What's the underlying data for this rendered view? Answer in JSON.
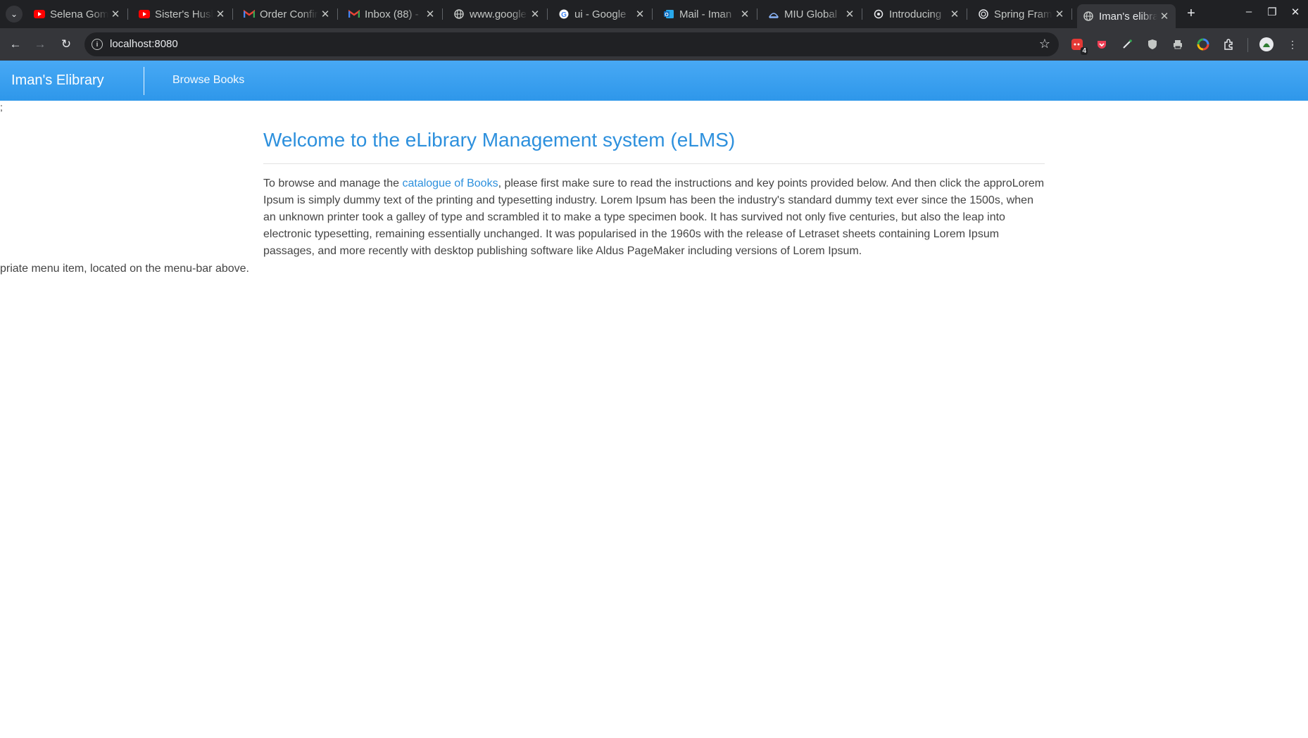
{
  "browser": {
    "tabs": [
      {
        "title": "Selena Gomez",
        "favicon": "youtube-icon",
        "color": "#ff0000"
      },
      {
        "title": "Sister's Husband",
        "favicon": "youtube-icon",
        "color": "#ff0000"
      },
      {
        "title": "Order Confirmation",
        "favicon": "gmail-icon",
        "color": "#ea4335"
      },
      {
        "title": "Inbox (88) -",
        "favicon": "gmail-icon",
        "color": "#ea4335"
      },
      {
        "title": "www.google",
        "favicon": "globe-icon",
        "color": "#c4c7c5"
      },
      {
        "title": "ui - Google",
        "favicon": "google-icon",
        "color": "#ffffff"
      },
      {
        "title": "Mail - Iman",
        "favicon": "outlook-icon",
        "color": "#0f6cbd"
      },
      {
        "title": "MIU Global",
        "favicon": "miu-icon",
        "color": "#8ab4f8"
      },
      {
        "title": "Introducing",
        "favicon": "openai-icon",
        "color": "#e8eaed"
      },
      {
        "title": "Spring Framework",
        "favicon": "spring-icon",
        "color": "#e8eaed"
      },
      {
        "title": "Iman's elibrary",
        "favicon": "globe-icon",
        "color": "#c4c7c5",
        "active": true
      }
    ],
    "url": "localhost:8080",
    "extension_badge": "4"
  },
  "app": {
    "brand": "Iman's Elibrary",
    "nav_link": "Browse Books",
    "stray_text": ";",
    "heading": "Welcome to the eLibrary Management system (eLMS)",
    "para_before_link": "To browse and manage the ",
    "link_text": "catalogue of Books",
    "para_after_link": ", please first make sure to read the instructions and key points provided below. And then click the approLorem Ipsum is simply dummy text of the printing and typesetting industry. Lorem Ipsum has been the industry's standard dummy text ever since the 1500s, when an unknown printer took a galley of type and scrambled it to make a type specimen book. It has survived not only five centuries, but also the leap into electronic typesetting, remaining essentially unchanged. It was popularised in the 1960s with the release of Letraset sheets containing Lorem Ipsum passages, and more recently with desktop publishing software like Aldus PageMaker including versions of Lorem Ipsum.",
    "overflow_text": "priate menu item, located on the menu-bar above.",
    "accent_color": "#2d90dd"
  }
}
